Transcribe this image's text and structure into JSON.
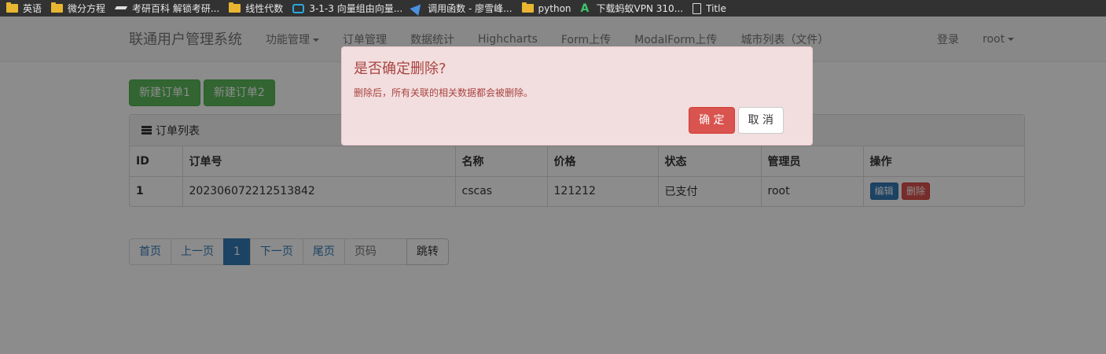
{
  "bookmarks": [
    {
      "label": "英语",
      "icon": "folder-icon"
    },
    {
      "label": "微分方程",
      "icon": "folder-icon"
    },
    {
      "label": "考研百科 解锁考研...",
      "icon": "graduation-cap-icon"
    },
    {
      "label": "线性代数",
      "icon": "folder-icon"
    },
    {
      "label": "3-1-3 向量组由向量...",
      "icon": "tv-icon"
    },
    {
      "label": "调用函数 - 廖雪峰...",
      "icon": "paper-plane-icon"
    },
    {
      "label": "python",
      "icon": "folder-icon"
    },
    {
      "label": "下载蚂蚁VPN 310...",
      "icon": "site-logo-icon"
    },
    {
      "label": "Title",
      "icon": "document-icon"
    }
  ],
  "navbar": {
    "brand": "联通用户管理系统",
    "items": [
      "功能管理",
      "订单管理",
      "数据统计",
      "Highcharts",
      "Form上传",
      "ModalForm上传",
      "城市列表（文件）"
    ],
    "right": [
      "登录",
      "root"
    ]
  },
  "actions": {
    "new1": "新建订单1",
    "new2": "新建订单2"
  },
  "panel": {
    "title": "订单列表",
    "columns": [
      "ID",
      "订单号",
      "名称",
      "价格",
      "状态",
      "管理员",
      "操作"
    ],
    "rows": [
      {
        "id": "1",
        "oid": "202306072212513842",
        "title": "cscas",
        "price": "121212",
        "status": "已支付",
        "admin": "root",
        "edit": "编辑",
        "delete": "删除"
      }
    ]
  },
  "pagination": {
    "first": "首页",
    "prev": "上一页",
    "current": "1",
    "next": "下一页",
    "last": "尾页",
    "input_placeholder": "页码",
    "go": "跳转"
  },
  "dialog": {
    "title": "是否确定删除?",
    "message": "删除后，所有关联的相关数据都会被删除。",
    "confirm": "确 定",
    "cancel": "取 消"
  },
  "colors": {
    "overlay": "rgba(0,0,0,0.45)",
    "alert_bg": "#f2dede",
    "alert_text": "#a94442",
    "danger": "#d9534f",
    "success": "#5cb85c",
    "primary": "#337ab7"
  }
}
